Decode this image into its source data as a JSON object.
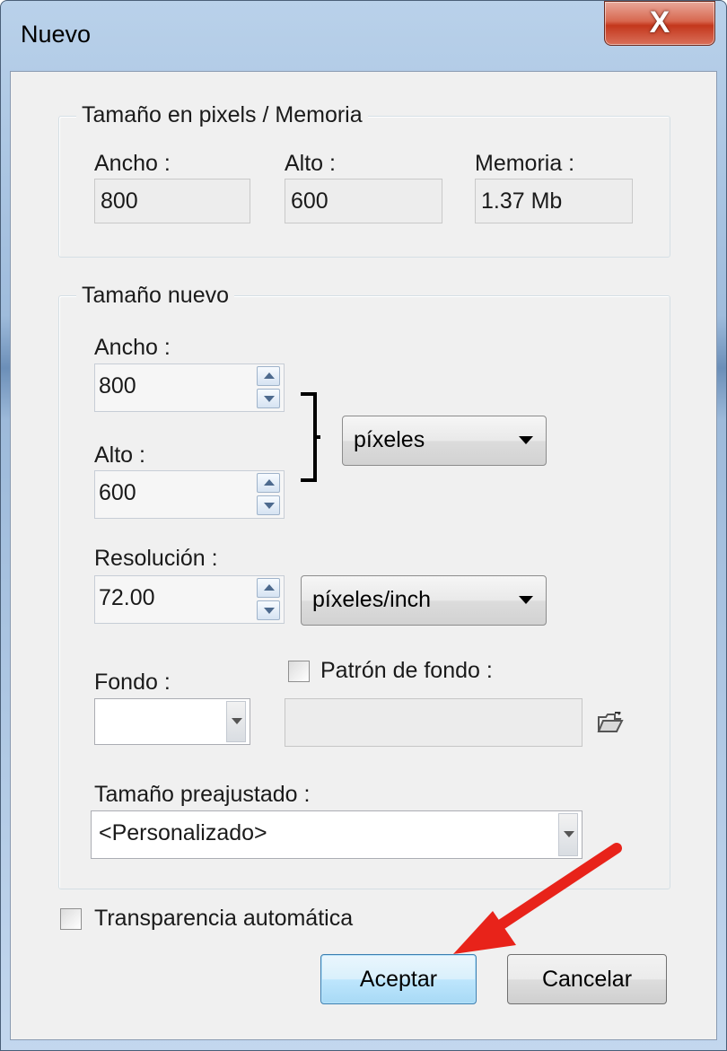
{
  "window": {
    "title": "Nuevo",
    "close_glyph": "X"
  },
  "memory_group": {
    "title": "Tamaño en pixels / Memoria",
    "width_label": "Ancho :",
    "width_value": "800",
    "height_label": "Alto :",
    "height_value": "600",
    "memory_label": "Memoria :",
    "memory_value": "1.37 Mb"
  },
  "new_size_group": {
    "title": "Tamaño nuevo",
    "width_label": "Ancho :",
    "width_value": "800",
    "height_label": "Alto :",
    "height_value": "600",
    "size_unit": "píxeles",
    "resolution_label": "Resolución :",
    "resolution_value": "72.00",
    "resolution_unit": "píxeles/inch",
    "background_label": "Fondo :",
    "pattern_label": "Patrón de fondo :",
    "preset_label": "Tamaño preajustado :",
    "preset_value": "<Personalizado>"
  },
  "auto_transparency_label": "Transparencia automática",
  "buttons": {
    "accept": "Aceptar",
    "cancel": "Cancelar"
  },
  "annotation": {
    "arrow_color": "#e8231a"
  }
}
